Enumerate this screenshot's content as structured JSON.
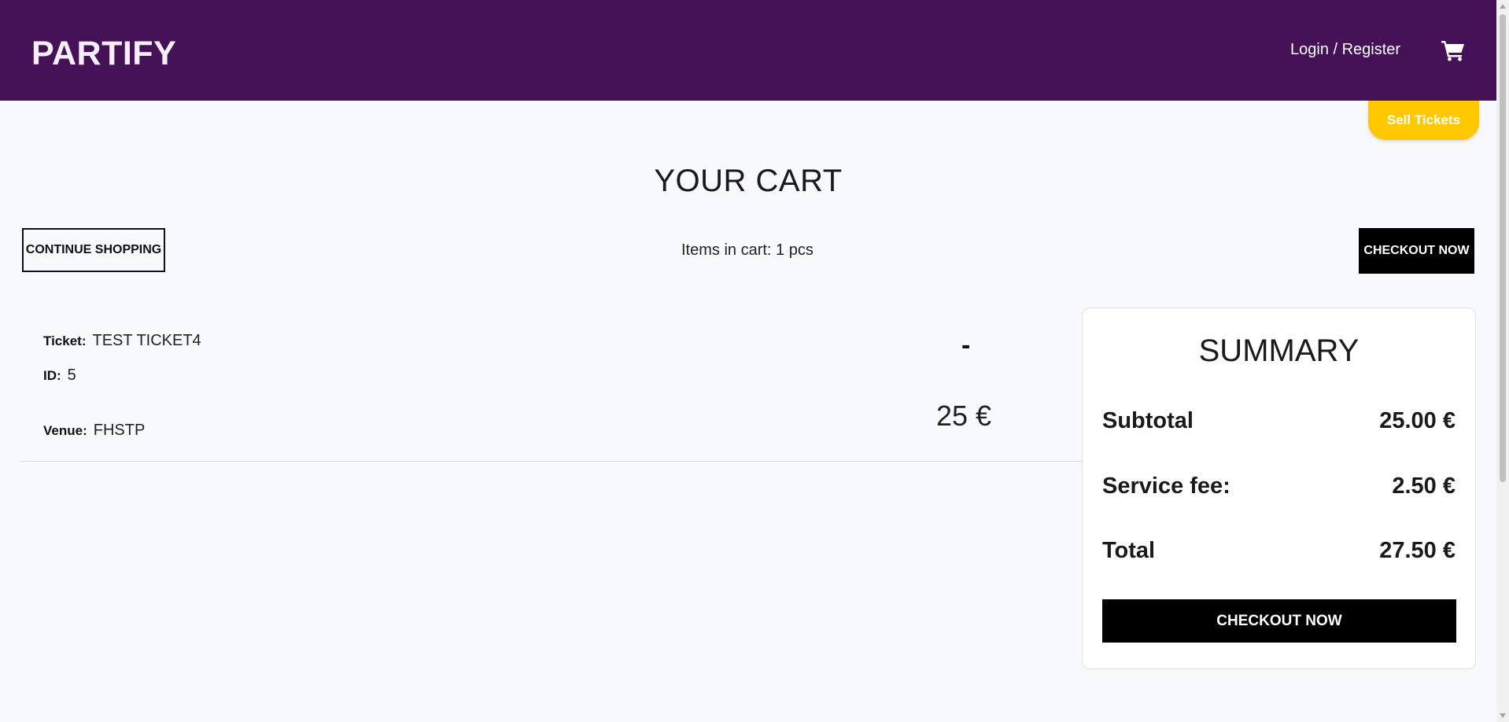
{
  "header": {
    "brand": "PARTIFY",
    "login_label": "Login / Register",
    "cart_icon": "shopping-cart-icon",
    "background_color": "#451257"
  },
  "sell_button": {
    "label": "Sell Tickets",
    "color": "#ffc800"
  },
  "page": {
    "title": "YOUR CART"
  },
  "toolbar": {
    "continue_label": "CONTINUE SHOPPING",
    "items_count": "Items in cart: 1 pcs",
    "checkout_label": "CHECKOUT NOW"
  },
  "cart_items": [
    {
      "ticket_label": "Ticket:",
      "ticket_value": "TEST TICKET4",
      "id_label": "ID:",
      "id_value": "5",
      "venue_label": "Venue:",
      "venue_value": "FHSTP",
      "remove_symbol": "-",
      "price": "25 €"
    }
  ],
  "summary": {
    "title": "SUMMARY",
    "subtotal_label": "Subtotal",
    "subtotal_value": "25.00 €",
    "fee_label": "Service fee:",
    "fee_value": "2.50 €",
    "total_label": "Total",
    "total_value": "27.50 €",
    "checkout_label": "CHECKOUT NOW"
  }
}
